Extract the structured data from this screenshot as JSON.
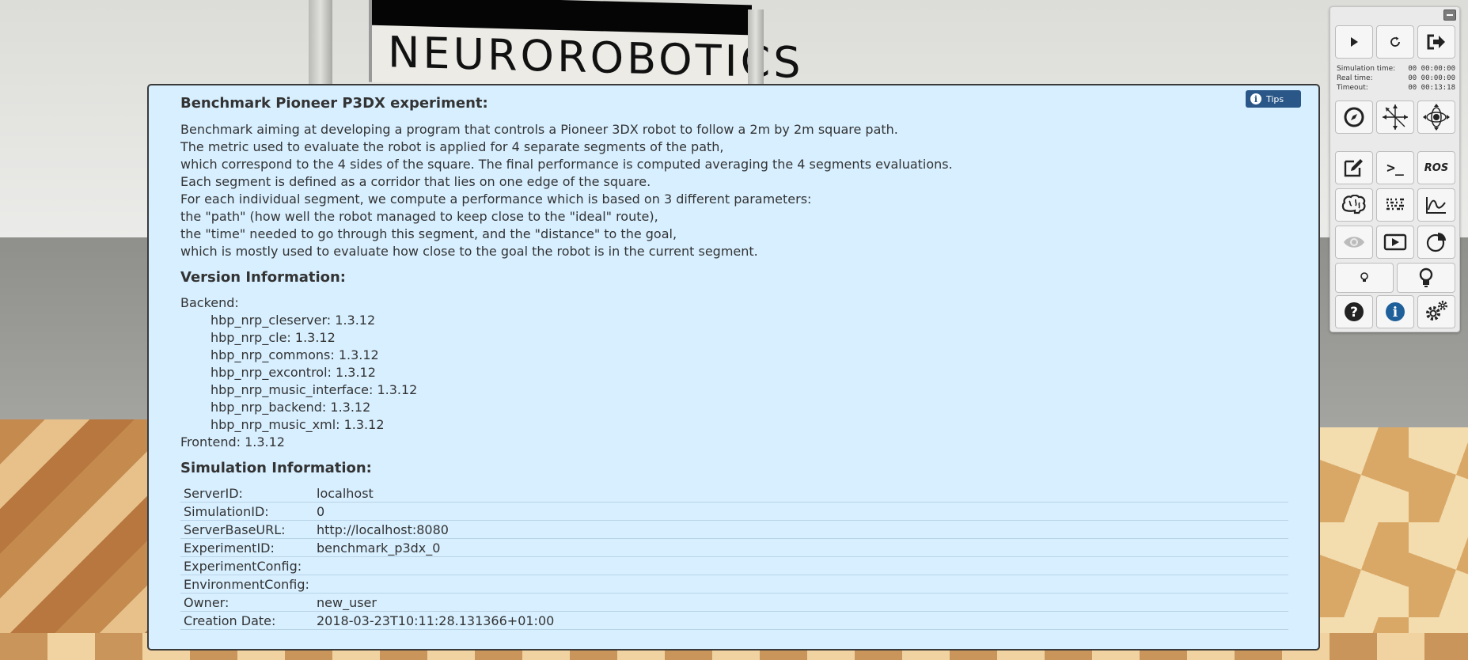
{
  "scene": {
    "sign_logo": "NEUROROBOTICS"
  },
  "info": {
    "title": "Benchmark Pioneer P3DX experiment:",
    "description_lines": [
      "Benchmark aiming at developing a program that controls a Pioneer 3DX robot to follow a 2m by 2m square path.",
      "The metric used to evaluate the robot is applied for 4 separate segments of the path,",
      "which correspond to the 4 sides of the square. The final performance is computed averaging the 4 segments evaluations.",
      "Each segment is defined as a corridor that lies on one edge of the square.",
      "For each individual segment, we compute a performance which is based on 3 different parameters:",
      "the \"path\" (how well the robot managed to keep close to the \"ideal\" route),",
      "the \"time\" needed to go through this segment, and the \"distance\" to the goal,",
      "which is mostly used to evaluate how close to the goal the robot is in the current segment."
    ],
    "tips_label": "Tips",
    "version_heading": "Version Information:",
    "backend_label": "Backend:",
    "backend_packages": [
      "hbp_nrp_cleserver: 1.3.12",
      "hbp_nrp_cle: 1.3.12",
      "hbp_nrp_commons: 1.3.12",
      "hbp_nrp_excontrol: 1.3.12",
      "hbp_nrp_music_interface: 1.3.12",
      "hbp_nrp_backend: 1.3.12",
      "hbp_nrp_music_xml: 1.3.12"
    ],
    "frontend_line": "Frontend: 1.3.12",
    "simulation_heading": "Simulation Information:",
    "simulation_rows": [
      {
        "key": "ServerID:",
        "value": "localhost"
      },
      {
        "key": "SimulationID:",
        "value": "0"
      },
      {
        "key": "ServerBaseURL:",
        "value": "http://localhost:8080"
      },
      {
        "key": "ExperimentID:",
        "value": "benchmark_p3dx_0"
      },
      {
        "key": "ExperimentConfig:",
        "value": ""
      },
      {
        "key": "EnvironmentConfig:",
        "value": ""
      },
      {
        "key": "Owner:",
        "value": "new_user"
      },
      {
        "key": "Creation Date:",
        "value": "2018-03-23T10:11:28.131366+01:00"
      }
    ]
  },
  "toolbar": {
    "simulation_time_label": "Simulation time:",
    "simulation_time_value": "00 00:00:00",
    "real_time_label": "Real time:",
    "real_time_value": "00 00:00:00",
    "timeout_label": "Timeout:",
    "timeout_value": "00 00:13:18",
    "ros_label": "ROS",
    "terminal_label": ">_",
    "icons": {
      "play": "play-icon",
      "reset": "reset-icon",
      "exit": "exit-icon",
      "navigation": "compass-icon",
      "object_move": "move-arrows-icon",
      "robot_orbit": "orbit-icon",
      "editor": "edit-icon",
      "terminal": "terminal-icon",
      "ros": "ros-icon",
      "brain": "brain-icon",
      "spike_monitor": "spike-train-icon",
      "joint_plot": "line-chart-icon",
      "camera_view": "eye-icon",
      "video_player": "video-icon",
      "performance": "pie-icon",
      "light_low": "light-bulb-small-icon",
      "light_high": "light-bulb-large-icon",
      "help": "help-icon",
      "info": "info-icon",
      "settings": "settings-icon"
    },
    "info_accent": "#1f5f9a"
  }
}
